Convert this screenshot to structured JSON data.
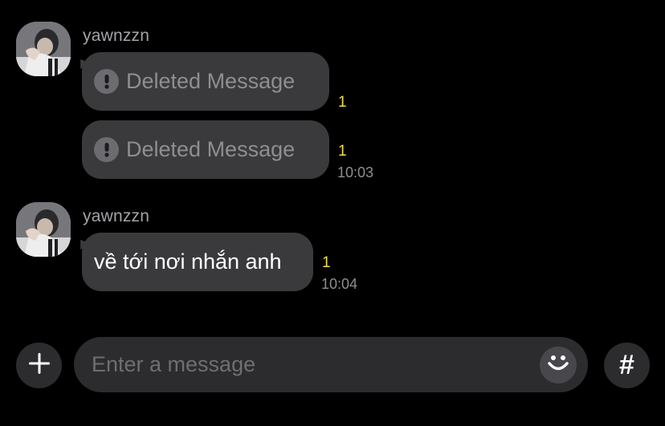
{
  "messages": [
    {
      "sender": "yawnzzn",
      "items": [
        {
          "type": "deleted",
          "text": "Deleted Message",
          "unread": "1",
          "time": ""
        },
        {
          "type": "deleted",
          "text": "Deleted Message",
          "unread": "1",
          "time": "10:03"
        }
      ]
    },
    {
      "sender": "yawnzzn",
      "items": [
        {
          "type": "text",
          "text": "về tới nơi nhắn anh",
          "unread": "1",
          "time": "10:04"
        }
      ]
    }
  ],
  "composer": {
    "placeholder": "Enter a message",
    "value": "",
    "hash_label": "#"
  },
  "icons": {
    "plus": "plus-icon",
    "emoji": "emoji-icon",
    "warning": "exclamation-icon",
    "hash": "hashtag-icon"
  },
  "colors": {
    "background": "#000000",
    "bubble": "#3a3a3c",
    "unread_count": "#f4de4c",
    "timestamp": "#8e8e93",
    "sender": "#a3a3a8"
  }
}
